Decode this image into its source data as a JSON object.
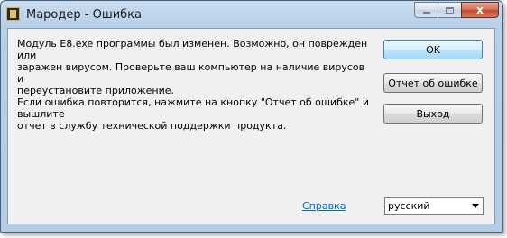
{
  "window": {
    "title": "Мародер - Ошибка",
    "app_icon": "marauder-app-icon"
  },
  "caption": {
    "minimize": "minimize-icon",
    "maximize": "maximize-icon",
    "close_glyph": "x"
  },
  "message": {
    "text": "Модуль E8.exe программы был изменен. Возможно, он поврежден или\nзаражен вирусом. Проверьте ваш компьютер на наличие вирусов и\nпереустановите приложение.\nЕсли ошибка повторится, нажмите на кнопку \"Отчет об ошибке\" и вышлите\nотчет в службу технической поддержки продукта."
  },
  "buttons": {
    "ok": "OK",
    "report": "Отчет об ошибке",
    "exit": "Выход"
  },
  "footer": {
    "help_link": "Справка",
    "language_value": "русский"
  }
}
